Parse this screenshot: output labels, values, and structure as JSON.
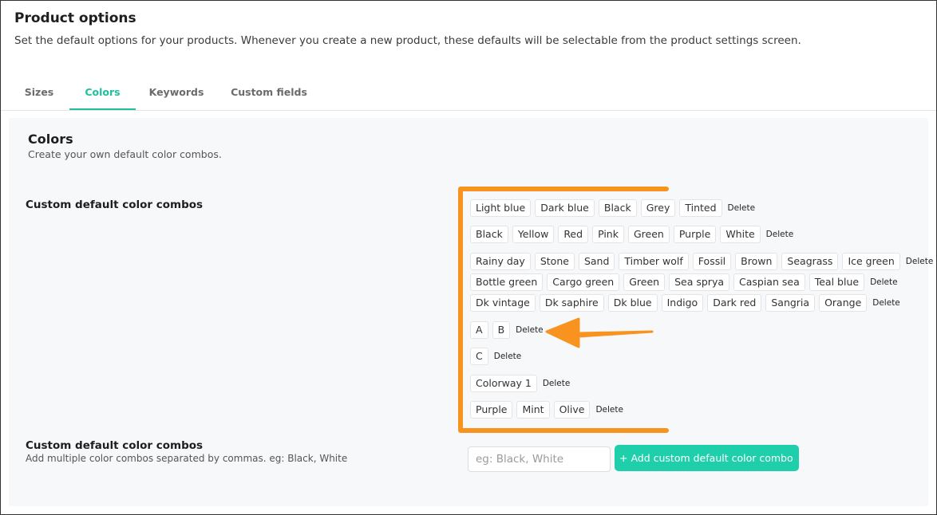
{
  "page": {
    "title": "Product options",
    "description": "Set the default options for your products. Whenever you create a new product, these defaults will be selectable from the product settings screen."
  },
  "tabs": [
    {
      "label": "Sizes",
      "active": false
    },
    {
      "label": "Colors",
      "active": true
    },
    {
      "label": "Keywords",
      "active": false
    },
    {
      "label": "Custom fields",
      "active": false
    }
  ],
  "colors": {
    "title": "Colors",
    "description": "Create your own default color combos.",
    "combos_label": "Custom default color combos",
    "delete_label": "Delete",
    "combos": [
      [
        "Light blue",
        "Dark blue",
        "Black",
        "Grey",
        "Tinted"
      ],
      [
        "Black",
        "Yellow",
        "Red",
        "Pink",
        "Green",
        "Purple",
        "White"
      ],
      [
        "Rainy day",
        "Stone",
        "Sand",
        "Timber wolf",
        "Fossil",
        "Brown",
        "Seagrass",
        "Ice green"
      ],
      [
        "Bottle green",
        "Cargo green",
        "Green",
        "Sea sprya",
        "Caspian sea",
        "Teal blue"
      ],
      [
        "Dk vintage",
        "Dk saphire",
        "Dk blue",
        "Indigo",
        "Dark red",
        "Sangria",
        "Orange"
      ],
      [
        "A",
        "B"
      ],
      [
        "C"
      ],
      [
        "Colorway 1"
      ],
      [
        "Purple",
        "Mint",
        "Olive"
      ]
    ],
    "add": {
      "label": "Custom default color combos",
      "help": "Add multiple color combos separated by commas. eg: Black, White",
      "placeholder": "eg: Black, White",
      "button_label": "+ Add custom default color combo"
    }
  },
  "annotation_color": "#f7931e",
  "accent_color": "#1fcfab"
}
